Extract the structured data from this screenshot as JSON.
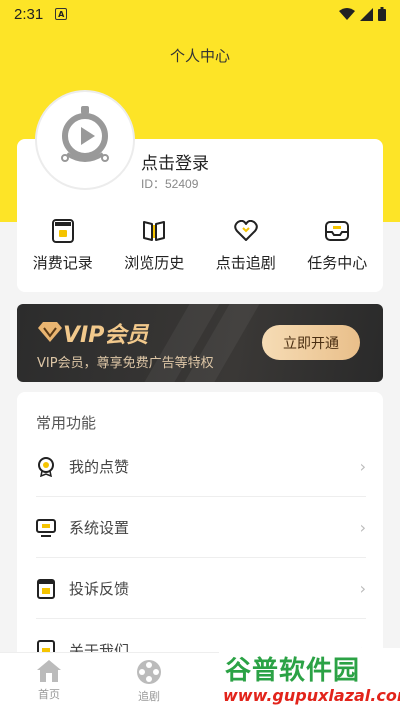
{
  "status_bar": {
    "time": "2:31",
    "notif_badge": "A"
  },
  "header": {
    "title": "个人中心"
  },
  "profile": {
    "login_label": "点击登录",
    "id_text": "ID：52409"
  },
  "quick_actions": [
    {
      "label": "消费记录",
      "icon": "wallet-icon"
    },
    {
      "label": "浏览历史",
      "icon": "book-icon"
    },
    {
      "label": "点击追剧",
      "icon": "heart-icon"
    },
    {
      "label": "任务中心",
      "icon": "inbox-icon"
    }
  ],
  "vip": {
    "title": "VIP会员",
    "description": "VIP会员，尊享免费广告等特权",
    "button": "立即开通",
    "colors": {
      "gold": "#f2c98c",
      "bg": "#2c2c2c"
    }
  },
  "functions": {
    "section_title": "常用功能",
    "items": [
      {
        "label": "我的点赞",
        "icon": "medal-icon"
      },
      {
        "label": "系统设置",
        "icon": "monitor-icon"
      },
      {
        "label": "投诉反馈",
        "icon": "document-icon"
      },
      {
        "label": "关于我们",
        "icon": "info-icon"
      }
    ]
  },
  "tab_bar": [
    {
      "label": "首页",
      "icon": "home-icon"
    },
    {
      "label": "追剧",
      "icon": "film-reel-icon"
    }
  ],
  "watermark": {
    "top": "谷普软件园",
    "bottom": "www.gupuxlazal.com"
  },
  "colors": {
    "brand_yellow": "#fde427",
    "page_bg": "#f4f4f4"
  }
}
